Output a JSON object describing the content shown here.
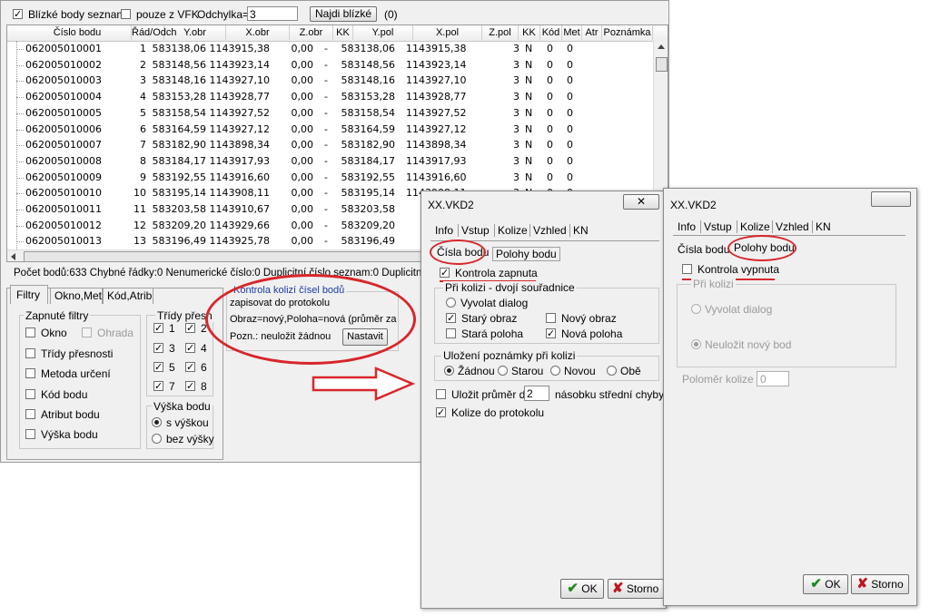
{
  "toolbar": {
    "nearby_list_label": "Blízké body seznam",
    "only_vfk_label": "pouze z VFK",
    "deviation_label": "Odchylka=",
    "deviation_value": "3",
    "find_button": "Najdi blízké",
    "result_count": "(0)"
  },
  "table": {
    "headers": [
      "Číslo bodu",
      "Řád/Odch",
      "Y.obr",
      "X.obr",
      "Z.obr",
      "KK",
      "Y.pol",
      "X.pol",
      "Z.pol",
      "KK",
      "Kód",
      "Met",
      "Atr",
      "Poznámka"
    ],
    "rows": [
      [
        "062005010001",
        "1",
        "583138,06",
        "1143915,38",
        "0,00",
        "-",
        "583138,06",
        "1143915,38",
        "",
        "3",
        "N",
        "0",
        "0"
      ],
      [
        "062005010002",
        "2",
        "583148,56",
        "1143923,14",
        "0,00",
        "-",
        "583148,56",
        "1143923,14",
        "",
        "3",
        "N",
        "0",
        "0"
      ],
      [
        "062005010003",
        "3",
        "583148,16",
        "1143927,10",
        "0,00",
        "-",
        "583148,16",
        "1143927,10",
        "",
        "3",
        "N",
        "0",
        "0"
      ],
      [
        "062005010004",
        "4",
        "583153,28",
        "1143928,77",
        "0,00",
        "-",
        "583153,28",
        "1143928,77",
        "",
        "3",
        "N",
        "0",
        "0"
      ],
      [
        "062005010005",
        "5",
        "583158,54",
        "1143927,52",
        "0,00",
        "-",
        "583158,54",
        "1143927,52",
        "",
        "3",
        "N",
        "0",
        "0"
      ],
      [
        "062005010006",
        "6",
        "583164,59",
        "1143927,12",
        "0,00",
        "-",
        "583164,59",
        "1143927,12",
        "",
        "3",
        "N",
        "0",
        "0"
      ],
      [
        "062005010007",
        "7",
        "583182,90",
        "1143898,34",
        "0,00",
        "-",
        "583182,90",
        "1143898,34",
        "",
        "3",
        "N",
        "0",
        "0"
      ],
      [
        "062005010008",
        "8",
        "583184,17",
        "1143917,93",
        "0,00",
        "-",
        "583184,17",
        "1143917,93",
        "",
        "3",
        "N",
        "0",
        "0"
      ],
      [
        "062005010009",
        "9",
        "583192,55",
        "1143916,60",
        "0,00",
        "-",
        "583192,55",
        "1143916,60",
        "",
        "3",
        "N",
        "0",
        "0"
      ],
      [
        "062005010010",
        "10",
        "583195,14",
        "1143908,11",
        "0,00",
        "-",
        "583195,14",
        "1143908,11",
        "",
        "3",
        "N",
        "0",
        "0"
      ],
      [
        "062005010011",
        "11",
        "583203,58",
        "1143910,67",
        "0,00",
        "-",
        "583203,58",
        "",
        "",
        "",
        "",
        "",
        ""
      ],
      [
        "062005010012",
        "12",
        "583209,20",
        "1143929,66",
        "0,00",
        "-",
        "583209,20",
        "",
        "",
        "",
        "",
        "",
        ""
      ],
      [
        "062005010013",
        "13",
        "583196,49",
        "1143925,78",
        "0,00",
        "-",
        "583196,49",
        "",
        "",
        "",
        "",
        "",
        ""
      ]
    ]
  },
  "status_bar": "Počet bodů:633  Chybné řádky:0  Nenumerické číslo:0  Duplicitní číslo seznam:0  Duplicitní číslo",
  "bottom_tabs": [
    "Filtry",
    "Okno,Met",
    "Kód,Atrib"
  ],
  "filters": {
    "group_title": "Zapnuté filtry",
    "items": [
      "Okno",
      "Ohrada",
      "Třídy přesnosti",
      "Metoda určení",
      "Kód bodu",
      "Atribut bodu",
      "Výška bodu"
    ],
    "classes_title": "Třídy přesn",
    "classes": [
      "1",
      "2",
      "3",
      "4",
      "5",
      "6",
      "7",
      "8"
    ],
    "height_title": "Výška bodu",
    "height_options": [
      "s výškou",
      "bez výšky"
    ]
  },
  "collision_box": {
    "title": "Kontrola kolizí čísel bodů",
    "line1": "zapisovat do protokolu",
    "line2": "Obraz=nový,Poloha=nová (průměr za",
    "line3": "Pozn.: neuložit žádnou",
    "button": "Nastavit"
  },
  "dialog1": {
    "title": "XX.VKD2",
    "tabs": [
      "Info",
      "Vstup",
      "Kolize",
      "Vzhled",
      "KN"
    ],
    "subtabs": [
      "Čísla bodu",
      "Polohy bodu"
    ],
    "check_enabled": "Kontrola zapnuta",
    "group_collision": "Při kolizi - dvojí souřadnice",
    "radio_dialog": "Vyvolat dialog",
    "old_image": "Starý obraz",
    "new_image": "Nový obraz",
    "old_position": "Stará poloha",
    "new_position": "Nová poloha",
    "group_note": "Uložení poznámky při kolizi",
    "note_options": [
      "Žádnou",
      "Starou",
      "Novou",
      "Obě"
    ],
    "save_avg_label": "Uložit průměr do",
    "save_avg_value": "2",
    "save_avg_suffix": "násobku střední chyby",
    "log_label": "Kolize do protokolu",
    "ok": "OK",
    "cancel": "Storno"
  },
  "dialog2": {
    "title": "XX.VKD2",
    "tabs": [
      "Info",
      "Vstup",
      "Kolize",
      "Vzhled",
      "KN"
    ],
    "subtabs": [
      "Čísla bodu",
      "Polohy bodu"
    ],
    "check_disabled": "Kontrola vypnuta",
    "group_collision": "Při kolizi",
    "radio_dialog": "Vyvolat dialog",
    "radio_no_save": "Neuložit nový bod",
    "radius_label": "Poloměr kolize",
    "radius_value": "0",
    "ok": "OK",
    "cancel": "Storno"
  },
  "colors": {
    "annotation_red": "#d8262b",
    "ok_green": "#1f8a1f",
    "cancel_red": "#c0141c"
  }
}
